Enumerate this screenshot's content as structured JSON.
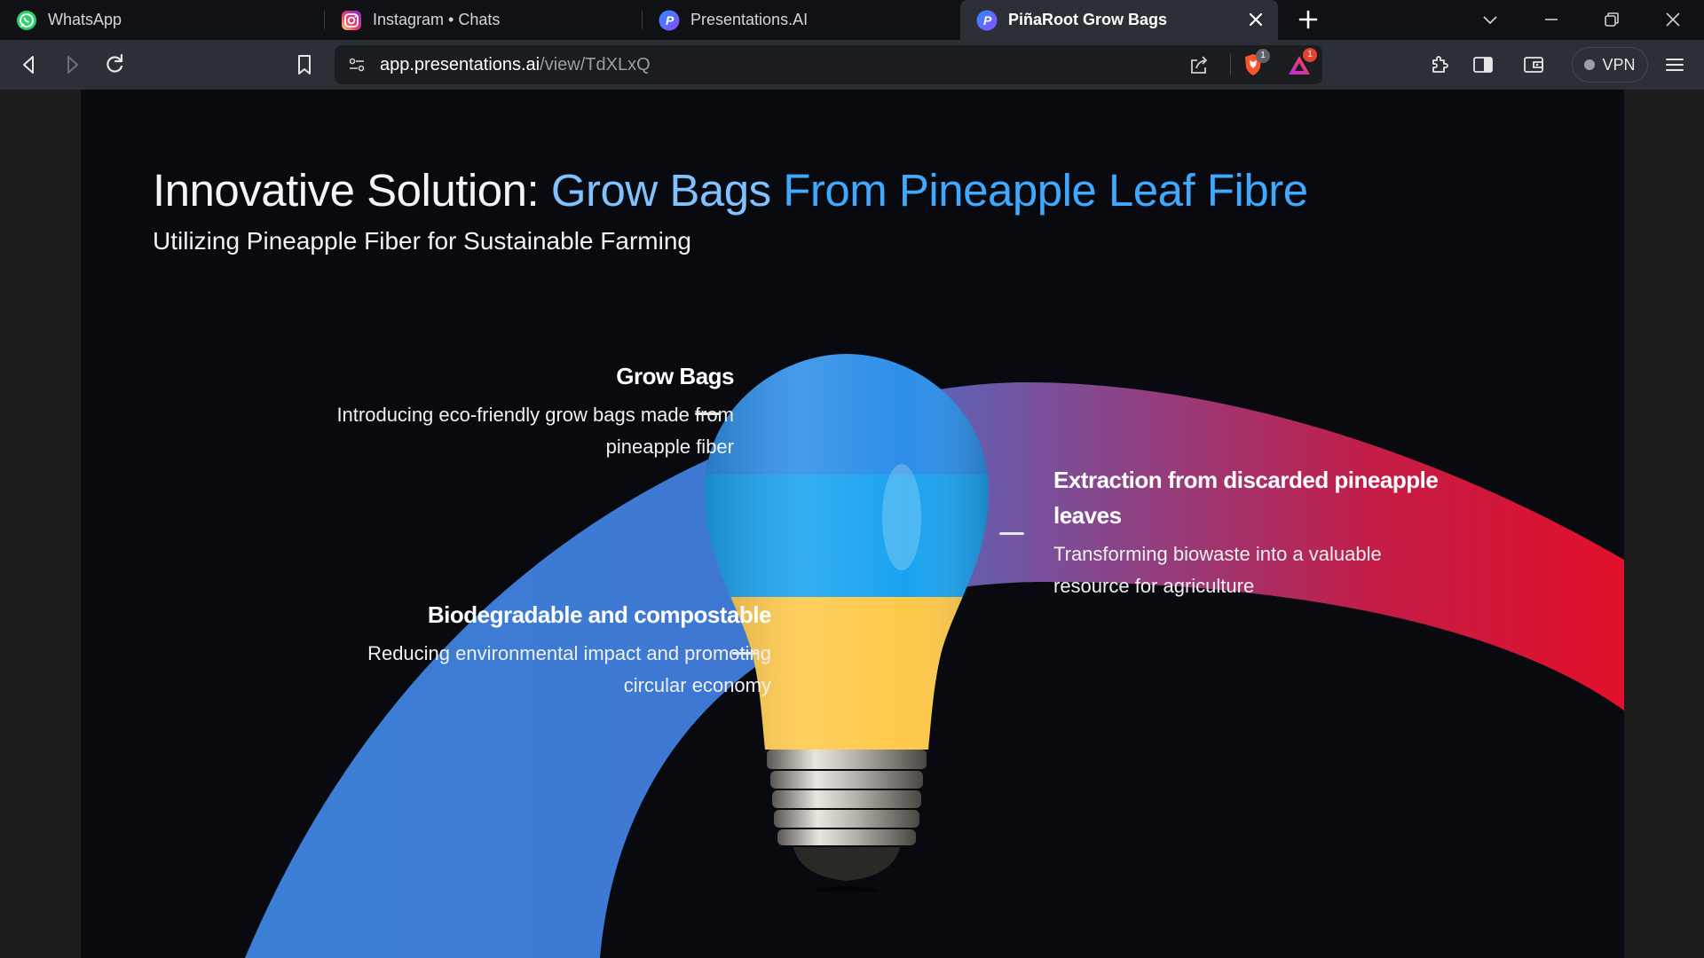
{
  "tabs": [
    {
      "title": "WhatsApp",
      "icon": "whatsapp-icon",
      "active": false
    },
    {
      "title": "Instagram • Chats",
      "icon": "instagram-icon",
      "active": false
    },
    {
      "title": "Presentations.AI",
      "icon": "presentations-ai-icon",
      "active": false
    },
    {
      "title": "PiñaRoot Grow Bags",
      "icon": "presentations-ai-icon",
      "active": true
    }
  ],
  "toolbar": {
    "url_host": "app.presentations.ai",
    "url_path": "/view/TdXLxQ",
    "brave_shields_count": "1",
    "rewards_count": "1",
    "vpn_label": "VPN"
  },
  "slide": {
    "title_part1": "Innovative Solution: ",
    "title_part2": "Grow Bags ",
    "title_part3": "From Pineapple Leaf Fibre",
    "subtitle": "Utilizing Pineapple Fiber for Sustainable Farming",
    "features": [
      {
        "heading": "Grow Bags",
        "text_line1": "Introducing eco-friendly grow bags made from",
        "text_line2": "pineapple fiber"
      },
      {
        "heading": "Extraction from discarded pineapple",
        "heading_line2": "leaves",
        "text_line1": "Transforming biowaste into a valuable",
        "text_line2": "resource for agriculture"
      },
      {
        "heading": "Biodegradable and compostable",
        "text_line1": "Reducing environmental impact and promoting",
        "text_line2": "circular economy"
      }
    ]
  },
  "colors": {
    "accent_blue": "#3ea9ff",
    "arc_blue": "#3b7fd4",
    "arc_red": "#e0112b",
    "bulb_blue": "#1aa3f0",
    "bulb_yellow": "#ffc94a"
  }
}
